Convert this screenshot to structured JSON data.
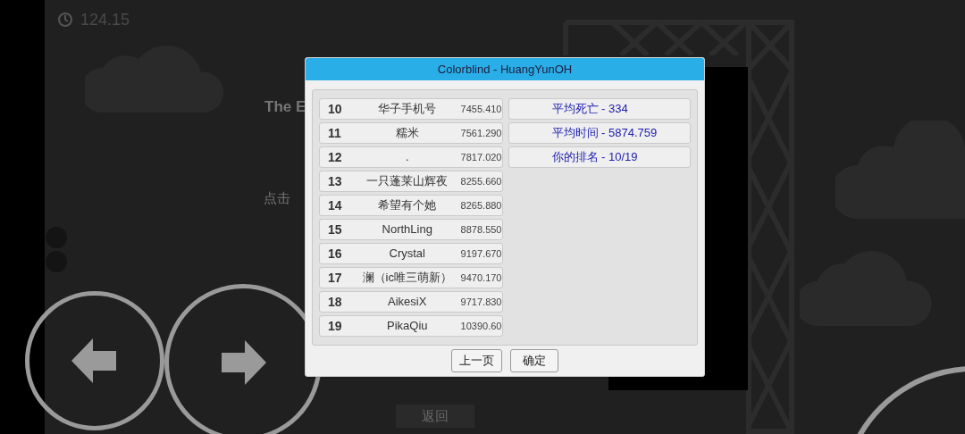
{
  "hud": {
    "timer": "124.15"
  },
  "background_texts": [
    "The E",
    "点击"
  ],
  "bottom_button": "返回",
  "dialog": {
    "title": "Colorblind - HuangYunOH",
    "rows": [
      {
        "rank": "10",
        "name": "华子手机号",
        "time": "7455.410"
      },
      {
        "rank": "11",
        "name": "糯米",
        "time": "7561.290"
      },
      {
        "rank": "12",
        "name": ".",
        "time": "7817.020"
      },
      {
        "rank": "13",
        "name": "一只蓬莱山辉夜",
        "time": "8255.660"
      },
      {
        "rank": "14",
        "name": "希望有个她",
        "time": "8265.880"
      },
      {
        "rank": "15",
        "name": "NorthLing",
        "time": "8878.550"
      },
      {
        "rank": "16",
        "name": "Crystal",
        "time": "9197.670"
      },
      {
        "rank": "17",
        "name": "澜（ic唯三萌新）",
        "time": "9470.170"
      },
      {
        "rank": "18",
        "name": "AikesiX",
        "time": "9717.830"
      },
      {
        "rank": "19",
        "name": "PikaQiu",
        "time": "10390.60"
      }
    ],
    "stats": [
      "平均死亡 - 334",
      "平均时间 - 5874.759",
      "你的排名 - 10/19"
    ],
    "buttons": [
      "上一页",
      "确定"
    ]
  }
}
